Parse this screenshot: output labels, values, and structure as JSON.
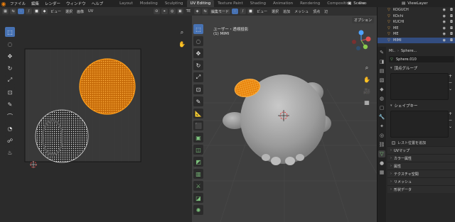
{
  "app": {
    "menu": [
      "ファイル",
      "編集",
      "レンダー",
      "ウィンドウ",
      "ヘルプ"
    ],
    "workspace_tabs": [
      "Layout",
      "Modeling",
      "Sculpting",
      "UV Editing",
      "Texture Paint",
      "Shading",
      "Animation",
      "Rendering",
      "Compositing",
      "Geo"
    ],
    "active_tab": "UV Editing",
    "scene": "Scene",
    "view_layer": "ViewLayer"
  },
  "uv_editor": {
    "menus": [
      "ビュー",
      "選択",
      "画像",
      "UV"
    ],
    "extra_label": "TE"
  },
  "viewport": {
    "mode": "編集モード",
    "menus": [
      "ビュー",
      "選択",
      "追加",
      "メッシュ",
      "頂点",
      "辺"
    ],
    "options": "オプション",
    "view_name": "ユーザー・透視投影",
    "object_info": "(1) MIMI"
  },
  "outliner": {
    "items": [
      {
        "name": "KOGUCH",
        "selected": false
      },
      {
        "name": "KOchi",
        "selected": false
      },
      {
        "name": "KUCHI",
        "selected": false
      },
      {
        "name": "ME",
        "selected": false
      },
      {
        "name": "ME",
        "selected": false
      },
      {
        "name": "MIMI",
        "selected": true
      }
    ]
  },
  "properties": {
    "object_short": "MI..",
    "mesh_name": "Sphere...",
    "data_name": "Sphere.010",
    "vertex_groups": "頂点グループ",
    "shape_keys": "シェイプキー",
    "relative_label": "レスト位置を追加",
    "collapsed_panels": [
      "UVマップ",
      "カラー属性",
      "属性",
      "テクスチャ空間",
      "リメッシュ",
      "形状データ"
    ]
  },
  "colors": {
    "accent_blue": "#4772b3",
    "selection_orange": "#e8820c",
    "blender_orange": "#e87d0d"
  }
}
